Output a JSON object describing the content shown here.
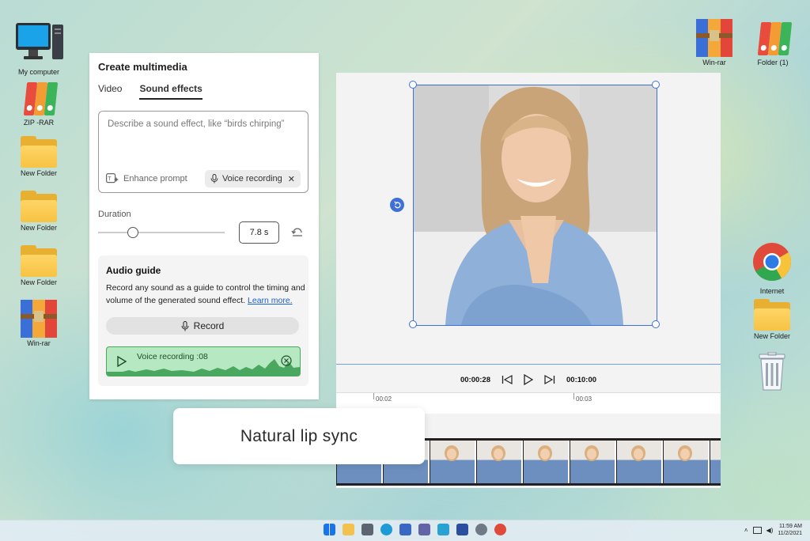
{
  "desktop": {
    "left_icons": [
      {
        "label": "My computer",
        "type": "computer"
      },
      {
        "label": "ZIP -RAR",
        "type": "binders"
      },
      {
        "label": "New Folder",
        "type": "folder"
      },
      {
        "label": "New Folder",
        "type": "folder"
      },
      {
        "label": "New Folder",
        "type": "folder"
      },
      {
        "label": "Win-rar",
        "type": "rar"
      }
    ],
    "right_top_icons": [
      {
        "label": "Win-rar",
        "type": "rar"
      },
      {
        "label": "Folder (1)",
        "type": "binders"
      }
    ],
    "right_icons": [
      {
        "label": "Internet",
        "type": "chrome"
      },
      {
        "label": "New Folder",
        "type": "folder"
      },
      {
        "label": "",
        "type": "recycle-bin"
      }
    ]
  },
  "panel": {
    "title": "Create multimedia",
    "tabs": [
      {
        "label": "Video",
        "active": false
      },
      {
        "label": "Sound effects",
        "active": true
      }
    ],
    "prompt": {
      "placeholder": "Describe a sound effect, like “birds chirping”",
      "value": "",
      "enhance_label": "Enhance prompt",
      "voice_chip_label": "Voice recording"
    },
    "duration": {
      "label": "Duration",
      "value_label": "7.8 s",
      "slider_fraction": 0.27
    },
    "audio_guide": {
      "title": "Audio guide",
      "description": "Record any sound as a guide to control the timing and volume of the generated sound effect.",
      "learn_more": "Learn more.",
      "record_label": "Record",
      "recording_label": "Voice recording :08"
    }
  },
  "editor": {
    "current_time": "00:00:28",
    "total_time": "00:10:00",
    "ruler_marks": [
      "00:02",
      "00:03"
    ],
    "accent_color": "#3f6fd8"
  },
  "overlay": {
    "caption": "Natural lip sync"
  },
  "taskbar": {
    "time": "11:59 AM",
    "date": "11/2/2021"
  }
}
